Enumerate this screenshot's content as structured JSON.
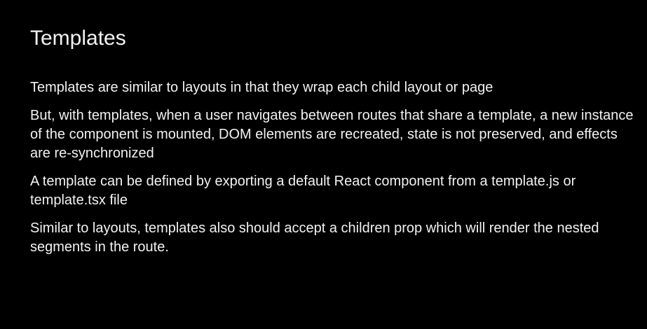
{
  "slide": {
    "title": "Templates",
    "paragraphs": [
      "Templates are similar to layouts in that they wrap each child layout or page",
      "But, with templates, when a user navigates between routes that share a template, a new instance of the component is mounted, DOM elements are recreated, state is not preserved, and effects are re-synchronized",
      "A template can be defined by exporting a default React component from a template.js or template.tsx file",
      "Similar to layouts, templates also should accept a children prop which will render the nested segments in the route."
    ]
  }
}
